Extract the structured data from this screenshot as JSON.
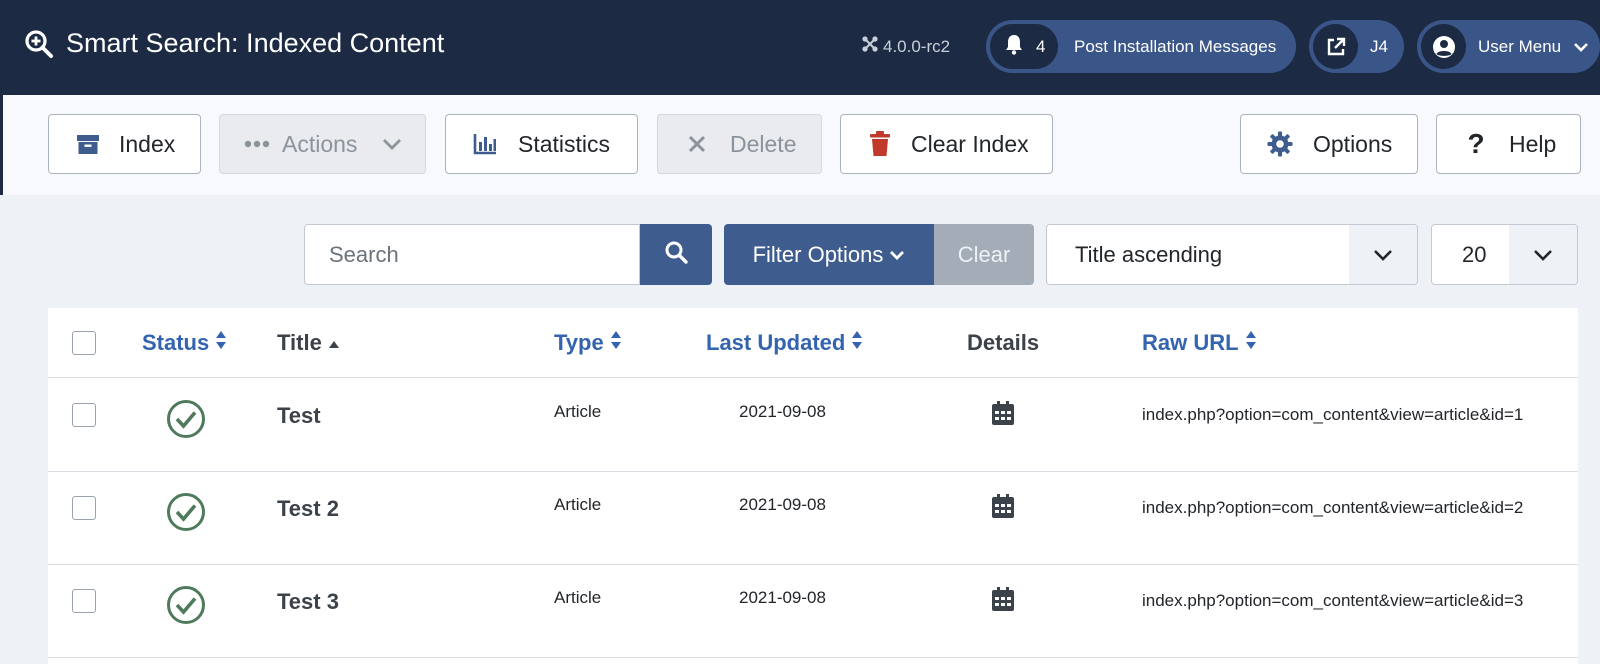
{
  "header": {
    "title": "Smart Search: Indexed Content",
    "version": "4.0.0-rc2",
    "post_install_count": "4",
    "post_install_label": "Post Installation Messages",
    "site_label": "J4",
    "user_menu_label": "User Menu"
  },
  "toolbar": {
    "index_label": "Index",
    "actions_label": "Actions",
    "statistics_label": "Statistics",
    "delete_label": "Delete",
    "clear_index_label": "Clear Index",
    "options_label": "Options",
    "help_label": "Help"
  },
  "filters": {
    "search_placeholder": "Search",
    "filter_options_label": "Filter Options",
    "clear_label": "Clear",
    "sort_value": "Title ascending",
    "limit_value": "20"
  },
  "table": {
    "columns": {
      "status": "Status",
      "title": "Title",
      "type": "Type",
      "last_updated": "Last Updated",
      "details": "Details",
      "raw_url": "Raw URL"
    },
    "rows": [
      {
        "title": "Test",
        "type": "Article",
        "date": "2021-09-08",
        "url": "index.php?option=com_content&view=article&id=1"
      },
      {
        "title": "Test 2",
        "type": "Article",
        "date": "2021-09-08",
        "url": "index.php?option=com_content&view=article&id=2"
      },
      {
        "title": "Test 3",
        "type": "Article",
        "date": "2021-09-08",
        "url": "index.php?option=com_content&view=article&id=3"
      }
    ]
  },
  "colors": {
    "header_bg": "#1c2a43",
    "pill_bg": "#3a5689",
    "primary": "#3e5d8e",
    "link": "#3464b0",
    "danger": "#c0392b",
    "success": "#4f7a5c"
  },
  "icons": {
    "title": "magnifier-plus-icon",
    "version": "joomla-icon",
    "notifications": "bell-icon",
    "site": "external-link-icon",
    "user": "user-circle-icon",
    "index": "archive-box-icon",
    "actions": "ellipsis-icon",
    "statistics": "bar-chart-icon",
    "delete": "close-icon",
    "clear_index": "trash-icon",
    "options": "gear-icon",
    "help": "question-icon",
    "status": "check-circle-icon",
    "details": "calendar-icon"
  }
}
